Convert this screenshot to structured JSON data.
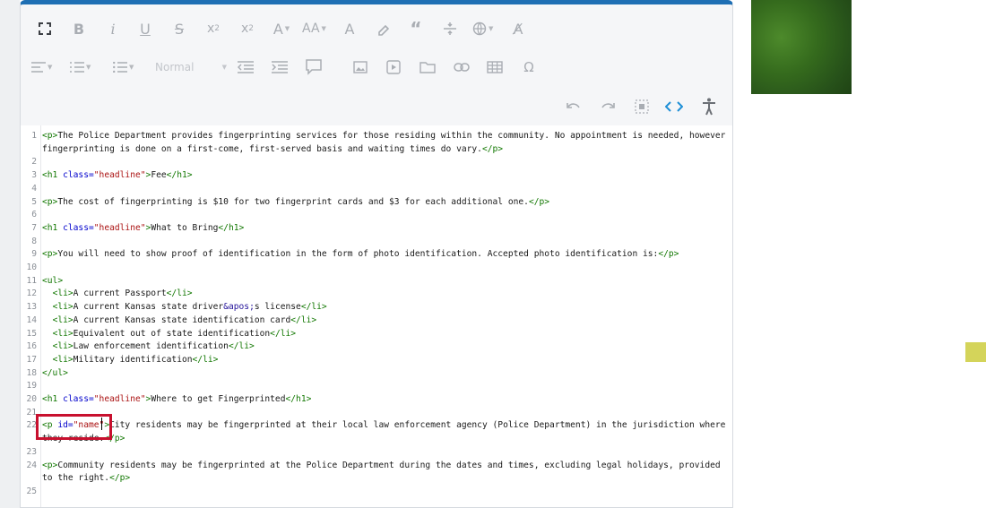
{
  "editor": {
    "toolbar": {
      "block_format": "Normal"
    },
    "code_lines": [
      {
        "n": "1",
        "parts": [
          [
            "tag",
            "<p>"
          ],
          [
            "text",
            "The Police Department provides fingerprinting services for those residing within the community. No appointment is needed, however"
          ]
        ]
      },
      {
        "n": "",
        "parts": [
          [
            "text",
            "fingerprinting is done on a first-come, first-served basis and waiting times do vary."
          ],
          [
            "tag",
            "</p>"
          ]
        ]
      },
      {
        "n": "2",
        "parts": []
      },
      {
        "n": "3",
        "parts": [
          [
            "tag",
            "<h1 "
          ],
          [
            "attr",
            "class="
          ],
          [
            "str",
            "\"headline\""
          ],
          [
            "tag",
            ">"
          ],
          [
            "text",
            "Fee"
          ],
          [
            "tag",
            "</h1>"
          ]
        ]
      },
      {
        "n": "4",
        "parts": []
      },
      {
        "n": "5",
        "parts": [
          [
            "tag",
            "<p>"
          ],
          [
            "text",
            "The cost of fingerprinting is $10 for two fingerprint cards and $3 for each additional one."
          ],
          [
            "tag",
            "</p>"
          ]
        ]
      },
      {
        "n": "6",
        "parts": []
      },
      {
        "n": "7",
        "parts": [
          [
            "tag",
            "<h1 "
          ],
          [
            "attr",
            "class="
          ],
          [
            "str",
            "\"headline\""
          ],
          [
            "tag",
            ">"
          ],
          [
            "text",
            "What to Bring"
          ],
          [
            "tag",
            "</h1>"
          ]
        ]
      },
      {
        "n": "8",
        "parts": []
      },
      {
        "n": "9",
        "parts": [
          [
            "tag",
            "<p>"
          ],
          [
            "text",
            "You will need to show proof of identification in the form of photo identification. Accepted photo identification is:"
          ],
          [
            "tag",
            "</p>"
          ]
        ]
      },
      {
        "n": "10",
        "parts": []
      },
      {
        "n": "11",
        "parts": [
          [
            "tag",
            "<ul>"
          ]
        ]
      },
      {
        "n": "12",
        "parts": [
          [
            "text",
            "  "
          ],
          [
            "tag",
            "<li>"
          ],
          [
            "text",
            "A current Passport"
          ],
          [
            "tag",
            "</li>"
          ]
        ]
      },
      {
        "n": "13",
        "parts": [
          [
            "text",
            "  "
          ],
          [
            "tag",
            "<li>"
          ],
          [
            "text",
            "A current Kansas state driver"
          ],
          [
            "ent",
            "&apos;"
          ],
          [
            "text",
            "s license"
          ],
          [
            "tag",
            "</li>"
          ]
        ]
      },
      {
        "n": "14",
        "parts": [
          [
            "text",
            "  "
          ],
          [
            "tag",
            "<li>"
          ],
          [
            "text",
            "A current Kansas state identification card"
          ],
          [
            "tag",
            "</li>"
          ]
        ]
      },
      {
        "n": "15",
        "parts": [
          [
            "text",
            "  "
          ],
          [
            "tag",
            "<li>"
          ],
          [
            "text",
            "Equivalent out of state identification"
          ],
          [
            "tag",
            "</li>"
          ]
        ]
      },
      {
        "n": "16",
        "parts": [
          [
            "text",
            "  "
          ],
          [
            "tag",
            "<li>"
          ],
          [
            "text",
            "Law enforcement identification"
          ],
          [
            "tag",
            "</li>"
          ]
        ]
      },
      {
        "n": "17",
        "parts": [
          [
            "text",
            "  "
          ],
          [
            "tag",
            "<li>"
          ],
          [
            "text",
            "Military identification"
          ],
          [
            "tag",
            "</li>"
          ]
        ]
      },
      {
        "n": "18",
        "parts": [
          [
            "tag",
            "</ul>"
          ]
        ]
      },
      {
        "n": "19",
        "parts": []
      },
      {
        "n": "20",
        "parts": [
          [
            "tag",
            "<h1 "
          ],
          [
            "attr",
            "class="
          ],
          [
            "str",
            "\"headline\""
          ],
          [
            "tag",
            ">"
          ],
          [
            "text",
            "Where to get Fingerprinted"
          ],
          [
            "tag",
            "</h1>"
          ]
        ]
      },
      {
        "n": "21",
        "parts": []
      },
      {
        "n": "22",
        "parts": [
          [
            "tag",
            "<p "
          ],
          [
            "attr",
            "id="
          ],
          [
            "str",
            "\"name\""
          ],
          [
            "tag",
            ">"
          ],
          [
            "text",
            "City residents may be fingerprinted at their local law enforcement agency (Police Department) in the jurisdiction where"
          ]
        ]
      },
      {
        "n": "",
        "parts": [
          [
            "text",
            "they reside."
          ],
          [
            "tag",
            "</p>"
          ]
        ]
      },
      {
        "n": "23",
        "parts": []
      },
      {
        "n": "24",
        "parts": [
          [
            "tag",
            "<p>"
          ],
          [
            "text",
            "Community residents may be fingerprinted at the Police Department during the dates and times, excluding legal holidays, provided"
          ]
        ]
      },
      {
        "n": "",
        "parts": [
          [
            "text",
            "to the right."
          ],
          [
            "tag",
            "</p>"
          ]
        ]
      },
      {
        "n": "25",
        "parts": []
      }
    ]
  },
  "colors": {
    "accent": "#1e6fb4",
    "active_icon": "#1e8fd6",
    "highlight": "#c8102e"
  }
}
